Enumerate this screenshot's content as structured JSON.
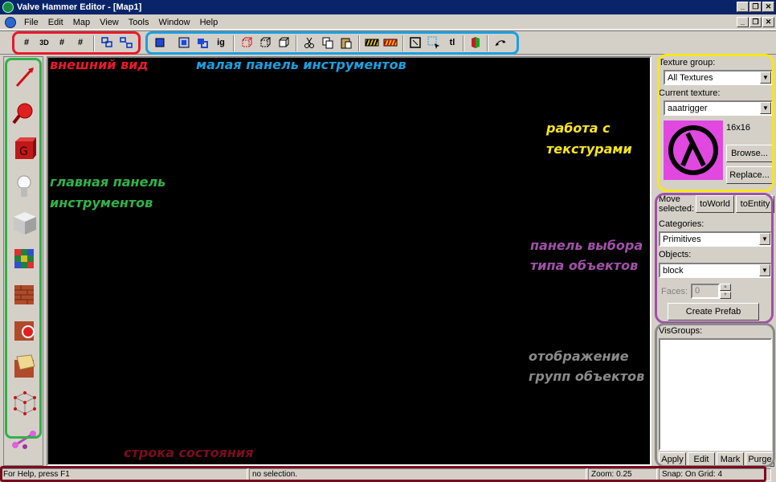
{
  "window": {
    "title": "Valve Hammer Editor - [Map1]",
    "min_glyph": "_",
    "restore_glyph": "❐",
    "close_glyph": "✕"
  },
  "menu": [
    "File",
    "Edit",
    "Map",
    "View",
    "Tools",
    "Window",
    "Help"
  ],
  "toolbar": {
    "grid_labels": [
      "#",
      "3D",
      "#",
      "#"
    ],
    "ig_label": "ig",
    "tl_label": "tl"
  },
  "annotations": {
    "appearance": "внешний вид",
    "small_toolbar": "малая панель инструментов",
    "main_toolbar_1": "главная панель",
    "main_toolbar_2": "инструментов",
    "texture_work_1": "работа с",
    "texture_work_2": "текстурами",
    "object_type_1": "панель выбора",
    "object_type_2": "типа объектов",
    "groups_1": "отображение",
    "groups_2": "групп объектов",
    "statusbar": "строка состояния"
  },
  "colors": {
    "red": "#e8192c",
    "blue": "#1aa0e0",
    "green": "#2fb34a",
    "yellow": "#f8e61a",
    "purple": "#a050a8",
    "gray": "#8a8a8a",
    "maroon": "#7a0c1e"
  },
  "texture_panel": {
    "group_label": "Texture group:",
    "group_value": "All Textures",
    "current_label": "Current texture:",
    "current_value": "aaatrigger",
    "size": "16x16",
    "browse": "Browse...",
    "replace": "Replace..."
  },
  "objects_panel": {
    "move_label_1": "Move",
    "move_label_2": "selected:",
    "to_world": "toWorld",
    "to_entity": "toEntity",
    "categories_label": "Categories:",
    "categories_value": "Primitives",
    "objects_label": "Objects:",
    "objects_value": "block",
    "faces_label": "Faces:",
    "faces_value": "0",
    "create_prefab": "Create Prefab"
  },
  "visgroups": {
    "label": "VisGroups:",
    "buttons": [
      "Apply",
      "Edit",
      "Mark",
      "Purge"
    ]
  },
  "status": {
    "help": "For Help, press F1",
    "selection": "no selection.",
    "zoom": "Zoom: 0.25",
    "snap": "Snap: On Grid: 4"
  },
  "main_tools": [
    "selection-tool-icon",
    "magnify-tool-icon",
    "camera-tool-icon",
    "entity-tool-icon",
    "block-tool-icon",
    "toggle-texture-app-icon",
    "apply-current-texture-icon",
    "apply-decals-icon",
    "overlay-tool-icon",
    "clipping-tool-icon",
    "vertex-tool-icon"
  ]
}
